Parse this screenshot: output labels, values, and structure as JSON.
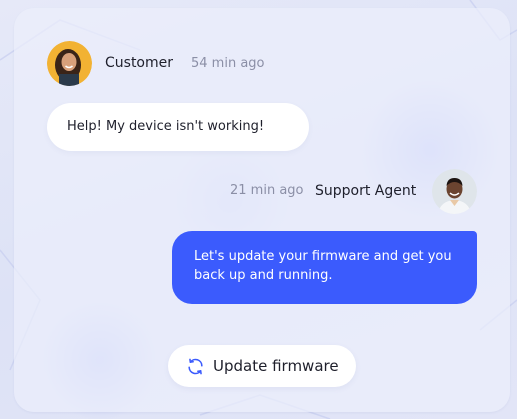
{
  "messages": {
    "customer": {
      "sender": "Customer",
      "time": "54 min ago",
      "text": "Help! My device isn't working!"
    },
    "agent": {
      "sender": "Support Agent",
      "time": "21 min ago",
      "text": "Let's update your firmware and get you back up and running."
    }
  },
  "action": {
    "label": "Update firmware",
    "icon": "refresh-icon"
  },
  "colors": {
    "accent": "#3b5bfd",
    "bubble_customer": "#ffffff",
    "time_text": "#8b8fa6",
    "name_text": "#1e1f2b"
  }
}
